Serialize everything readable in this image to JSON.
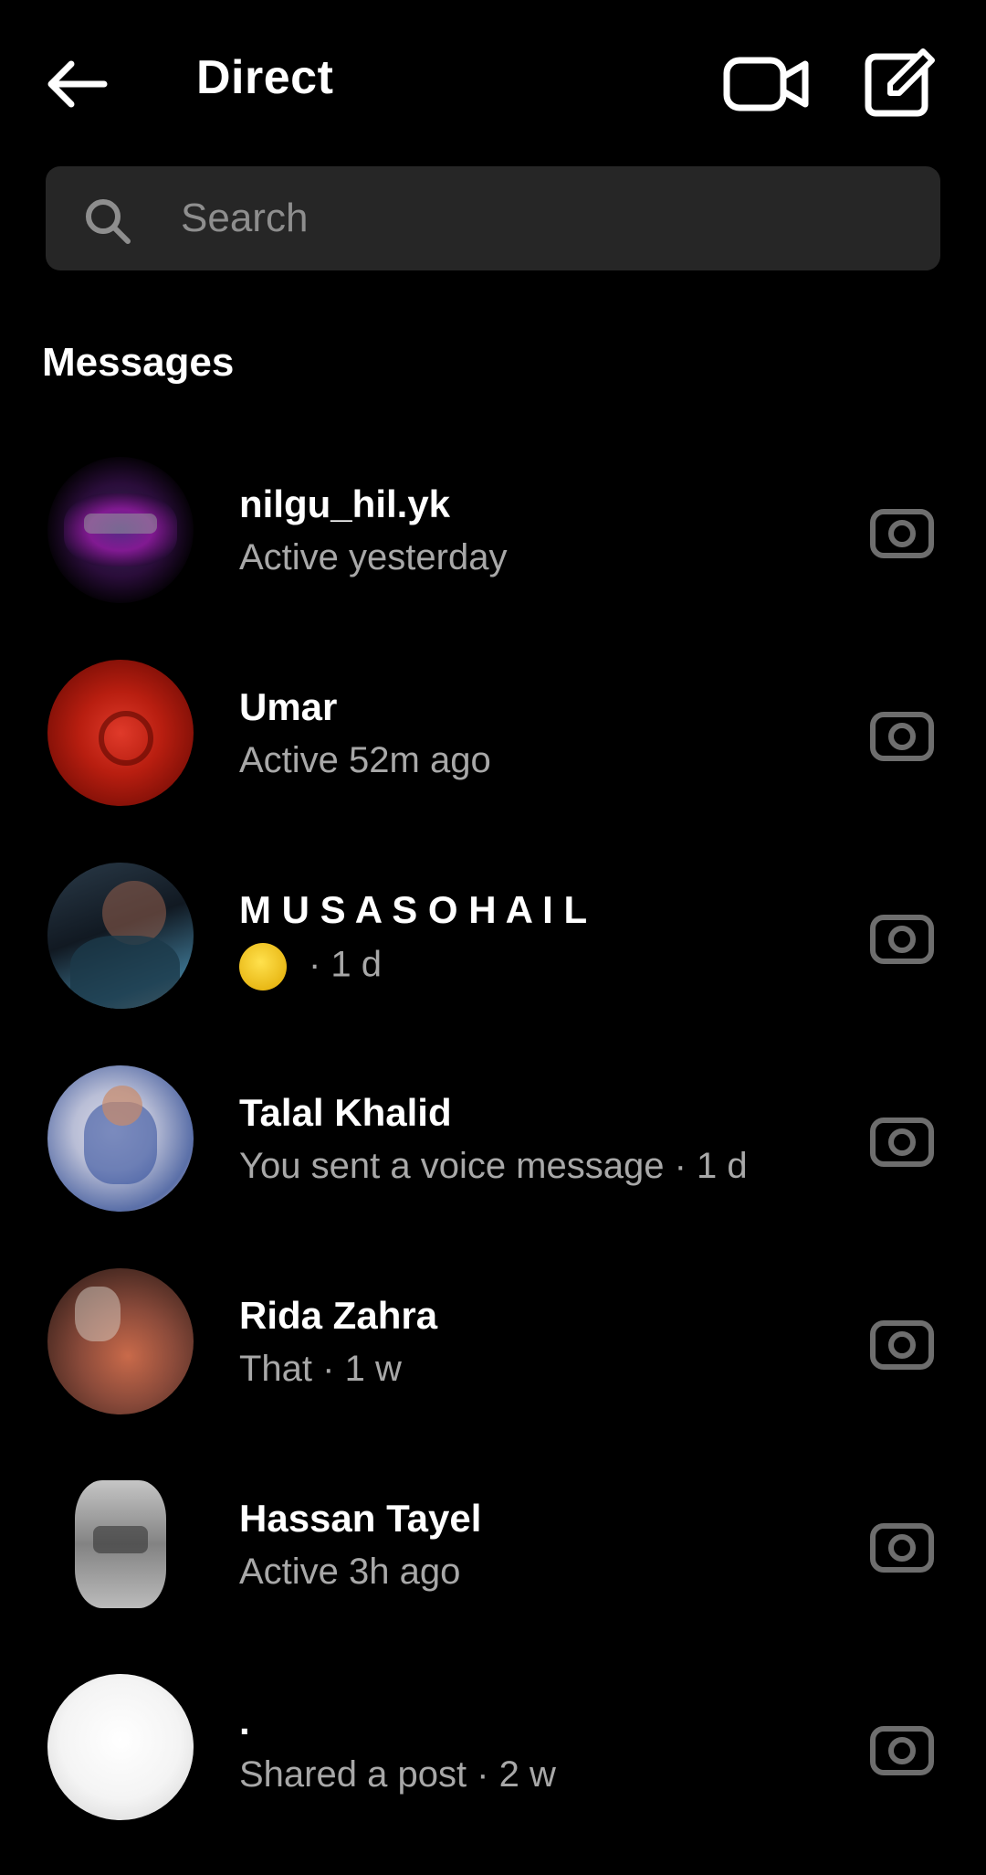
{
  "header": {
    "title": "Direct",
    "icons": [
      "back-arrow-icon",
      "video-camera-icon",
      "compose-icon"
    ]
  },
  "search": {
    "placeholder": "Search"
  },
  "section_title": "Messages",
  "conversations": [
    {
      "name": "nilgu_hil.yk",
      "status": "Active yesterday"
    },
    {
      "name": "Umar",
      "status": "Active 52m ago"
    },
    {
      "name": "M U S A   S O H A I L",
      "status": "· 1 d",
      "emoji": "😂"
    },
    {
      "name": "Talal Khalid",
      "status": "You sent a voice message · 1 d"
    },
    {
      "name": "Rida Zahra",
      "status": "That · 1 w"
    },
    {
      "name": "Hassan Tayel",
      "status": "Active 3h ago"
    },
    {
      "name": ".",
      "status": "Shared a post · 2 w"
    }
  ],
  "colors": {
    "background": "#000000",
    "search_bg": "#262626",
    "secondary_text": "#a8a8a8"
  }
}
